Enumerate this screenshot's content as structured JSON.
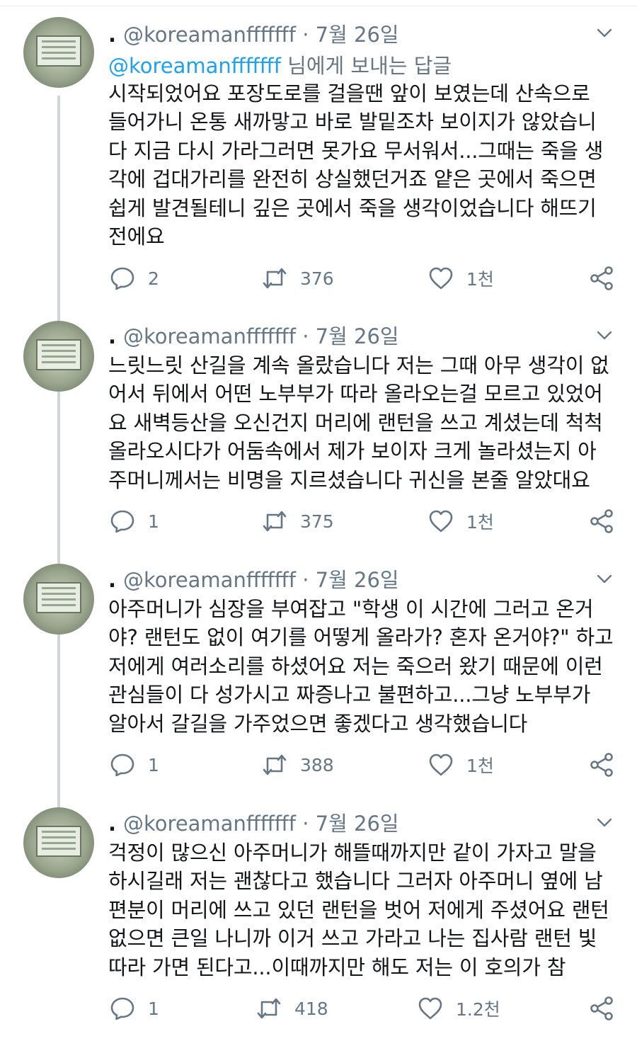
{
  "tweets": [
    {
      "handle": "@koreamanfffffff",
      "separator": "·",
      "date": "7월 26일",
      "reply_mention": "@koreamanfffffff",
      "reply_suffix": "님에게 보내는 답글",
      "text": "시작되었어요 포장도로를 걸을땐 앞이 보였는데 산속으로\n들어가니 온통 새까맣고 바로 발밑조차 보이지가 않았습니\n다 지금 다시 가라그러면 못가요 무서워서...그때는 죽을 생\n각에 겁대가리를 완전히 상실했던거죠 얕은 곳에서 죽으면\n쉽게 발견될테니 깊은 곳에서 죽을 생각이었습니다 해뜨기\n전에요",
      "replies": "2",
      "retweets": "376",
      "likes": "1천"
    },
    {
      "handle": "@koreamanfffffff",
      "separator": "·",
      "date": "7월 26일",
      "text": "느릿느릿 산길을 계속 올랐습니다 저는 그때 아무 생각이 없\n어서 뒤에서 어떤 노부부가 따라 올라오는걸 모르고 있었어\n요 새벽등산을 오신건지 머리에 랜턴을 쓰고 계셨는데 척척\n올라오시다가 어둠속에서 제가 보이자 크게 놀라셨는지 아\n주머니께서는 비명을 지르셨습니다 귀신을 본줄 알았대요",
      "replies": "1",
      "retweets": "375",
      "likes": "1천"
    },
    {
      "handle": "@koreamanfffffff",
      "separator": "·",
      "date": "7월 26일",
      "text": "아주머니가 심장을 부여잡고 \"학생 이 시간에 그러고 온거\n야? 랜턴도 없이 여기를 어떻게 올라가? 혼자 온거야?\" 하고\n저에게 여러소리를 하셨어요 저는 죽으러 왔기 때문에 이런\n관심들이 다 성가시고 짜증나고 불편하고...그냥 노부부가\n알아서 갈길을 가주었으면 좋겠다고 생각했습니다",
      "replies": "1",
      "retweets": "388",
      "likes": "1천"
    },
    {
      "handle": "@koreamanfffffff",
      "separator": "·",
      "date": "7월 26일",
      "text": "걱정이 많으신 아주머니가 해뜰때까지만 같이 가자고 말을\n하시길래 저는 괜찮다고 했습니다 그러자 아주머니 옆에 남\n편분이 머리에 쓰고 있던 랜턴을 벗어 저에게 주셨어요 랜턴\n없으면 큰일 나니까 이거 쓰고 가라고 나는 집사람 랜턴 빛\n따라 가면 된다고...이때까지만 해도 저는 이 호의가 참",
      "replies": "1",
      "retweets": "418",
      "likes": "1.2천"
    }
  ],
  "icons": {
    "reply": "reply-icon",
    "retweet": "retweet-icon",
    "like": "heart-icon",
    "share": "share-icon",
    "more": "chevron-down-icon"
  },
  "colors": {
    "text": "#14171a",
    "secondary": "#657786",
    "mention": "#1da1f2",
    "thread_line": "#ccd6dd"
  }
}
